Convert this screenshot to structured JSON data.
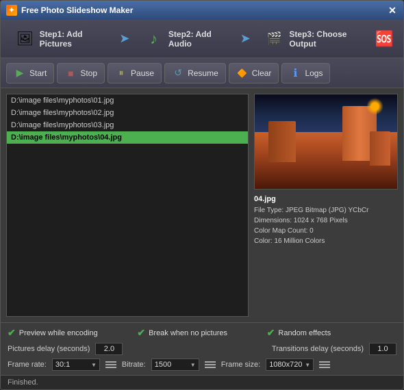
{
  "window": {
    "title": "Free Photo Slideshow Maker"
  },
  "steps": [
    {
      "label": "Step1: Add Pictures",
      "id": "step-pictures"
    },
    {
      "label": "Step2: Add Audio",
      "id": "step-audio"
    },
    {
      "label": "Step3: Choose Output",
      "id": "step-output"
    }
  ],
  "toolbar": {
    "start": "Start",
    "stop": "Stop",
    "pause": "Pause",
    "resume": "Resume",
    "clear": "Clear",
    "logs": "Logs"
  },
  "files": [
    {
      "path": "D:\\image files\\myphotos\\01.jpg",
      "selected": false
    },
    {
      "path": "D:\\image files\\myphotos\\02.jpg",
      "selected": false
    },
    {
      "path": "D:\\image files\\myphotos\\03.jpg",
      "selected": false
    },
    {
      "path": "D:\\image files\\myphotos\\04.jpg",
      "selected": true
    }
  ],
  "preview": {
    "filename": "04.jpg",
    "filetype": "File Type: JPEG Bitmap (JPG) YCbCr",
    "dimensions": "Dimensions: 1024 x 768 Pixels",
    "colormap": "Color Map Count: 0",
    "color": "Color: 16 Million Colors"
  },
  "options": {
    "preview_while_encoding": "Preview while encoding",
    "break_when_no_pictures": "Break when no pictures",
    "random_effects": "Random effects",
    "pictures_delay_label": "Pictures delay (seconds)",
    "pictures_delay_value": "2.0",
    "transitions_delay_label": "Transitions delay (seconds)",
    "transitions_delay_value": "1.0",
    "frame_rate_label": "Frame rate:",
    "frame_rate_value": "30:1",
    "bitrate_label": "Bitrate:",
    "bitrate_value": "1500",
    "frame_size_label": "Frame size:",
    "frame_size_value": "1080x720"
  },
  "status": "Finished."
}
